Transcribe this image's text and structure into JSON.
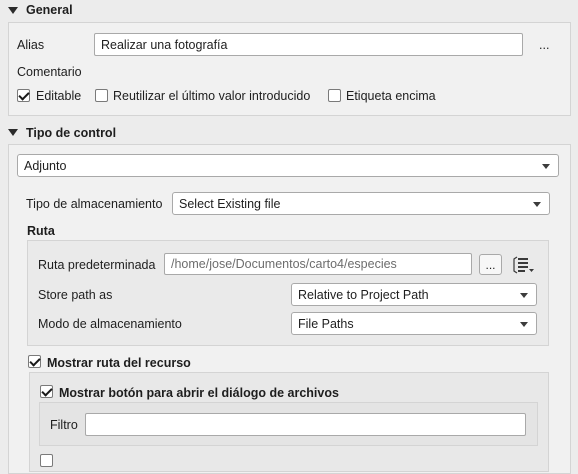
{
  "general": {
    "title": "General",
    "alias_label": "Alias",
    "alias_value": "Realizar una fotografía",
    "alias_menu": "...",
    "comment_label": "Comentario",
    "editable_label": "Editable",
    "editable_checked": true,
    "reuse_label": "Reutilizar el último valor introducido",
    "reuse_checked": false,
    "label_on_top_label": "Etiqueta encima",
    "label_on_top_checked": false
  },
  "control": {
    "title": "Tipo de control",
    "widget_type": "Adjunto",
    "storage_type_label": "Tipo de almacenamiento",
    "storage_type_value": "Select Existing file",
    "path_section_title": "Ruta",
    "default_path_label": "Ruta predeterminada",
    "default_path_value": "/home/jose/Documentos/carto4/especies",
    "browse_button": "...",
    "store_path_label": "Store path as",
    "store_path_value": "Relative to Project Path",
    "storage_mode_label": "Modo de almacenamiento",
    "storage_mode_value": "File Paths",
    "show_path_label": "Mostrar ruta del recurso",
    "show_path_checked": true,
    "show_open_dialog_label": "Mostrar botón para abrir el diálogo de archivos",
    "show_open_dialog_checked": true,
    "filter_label": "Filtro",
    "filter_value": ""
  }
}
